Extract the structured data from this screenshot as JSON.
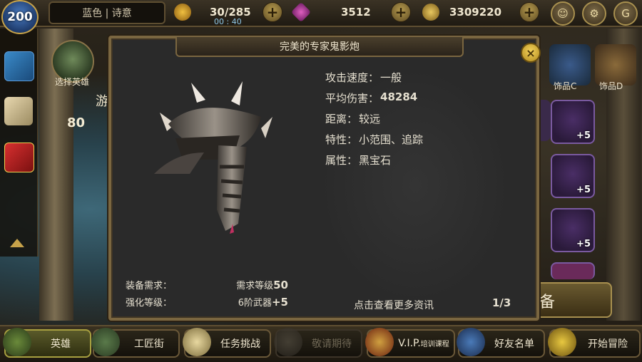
{
  "topbar": {
    "level": "200",
    "player_name": "蓝色 | 诗意",
    "stamina": "30/285",
    "stamina_timer": "00 : 40",
    "gems": "3512",
    "gold": "3309220"
  },
  "sidebar": {
    "hero_select_label": "选择英雄",
    "hero_partial_text": "游",
    "hero_count": "80"
  },
  "right_items": {
    "accessory_c": "饰品C",
    "accessory_d": "饰品D",
    "plus_label": "+5",
    "partial_5": "5"
  },
  "modal": {
    "title": "完美的专家鬼影炮",
    "stats": [
      {
        "label": "攻击速度：",
        "value": "一般"
      },
      {
        "label": "平均伤害：",
        "value": "48284"
      },
      {
        "label": "距离：",
        "value": "较远"
      },
      {
        "label": "特性：",
        "value": "小范围、追踪"
      },
      {
        "label": "属性：",
        "value": "黑宝石"
      }
    ],
    "equip_req_label": "装备需求：",
    "equip_req_prefix": "需求等级",
    "equip_req_value": "50",
    "enhance_label": "强化等级：",
    "enhance_prefix": "6阶武器",
    "enhance_value": "+5",
    "more_info": "点击查看更多资讯",
    "page": "1/3",
    "partial_button": "备"
  },
  "bottom_nav": [
    {
      "label": "英雄"
    },
    {
      "label": "工匠街"
    },
    {
      "label": "任务挑战"
    },
    {
      "label": "敬请期待"
    },
    {
      "label": "V.I.P.",
      "sub": "培训课程"
    },
    {
      "label": "好友名单"
    },
    {
      "label": "开始冒险"
    }
  ],
  "colors": {
    "frame_gold": "#7a6640",
    "panel_bg": "#2a2a2a",
    "close_yellow": "#f4d25a",
    "purple_item": "#4a2e66"
  }
}
